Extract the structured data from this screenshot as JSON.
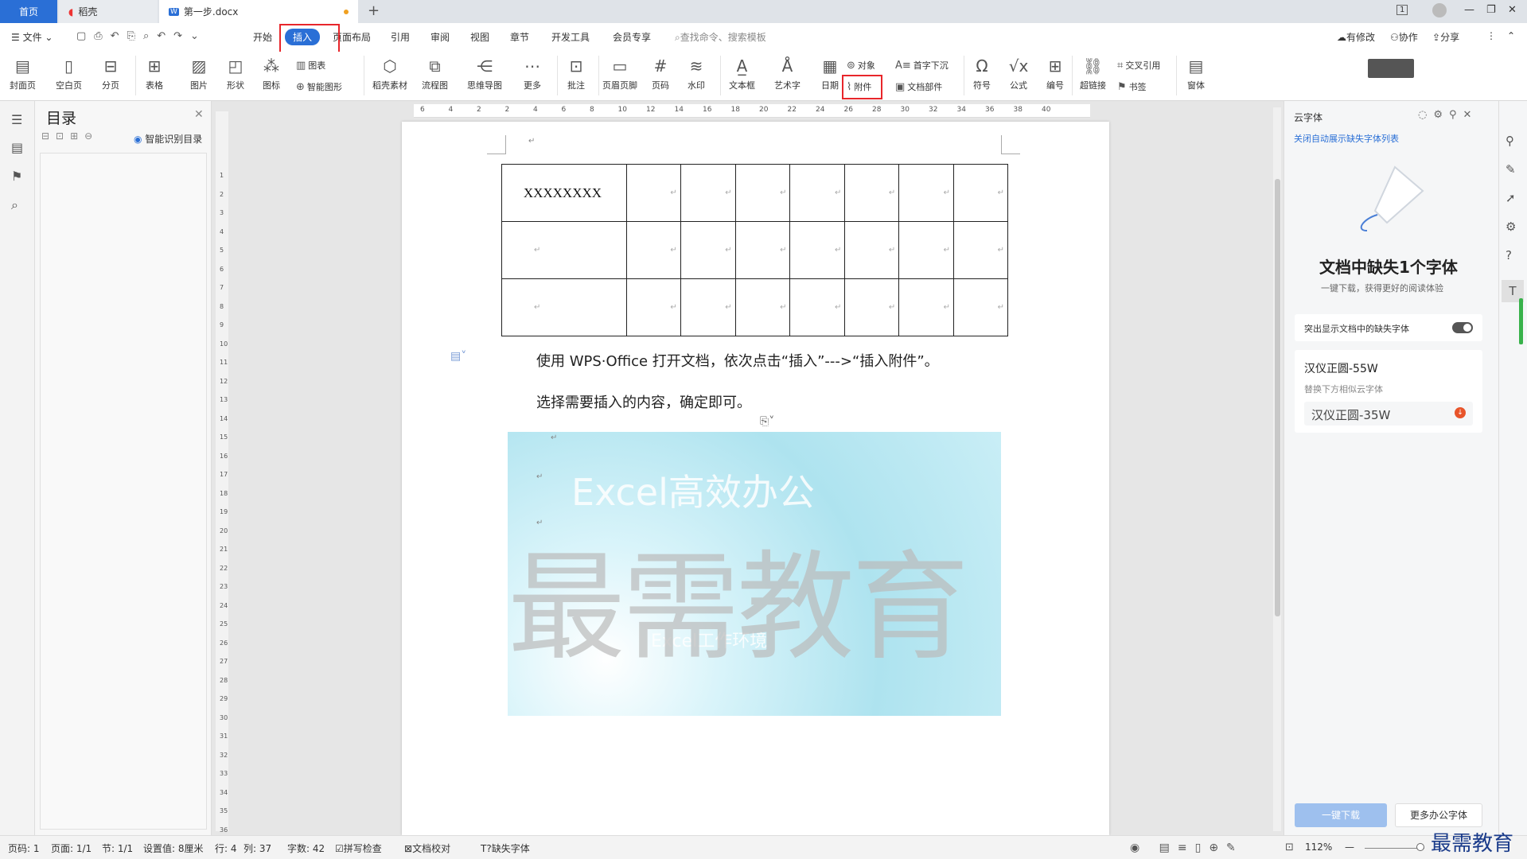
{
  "tabs": {
    "home": "首页",
    "docer": "稻壳",
    "doc": "第一步.docx",
    "add": "+"
  },
  "window": {
    "user_count": "1",
    "min": "—",
    "restore": "❐",
    "close": "✕"
  },
  "menu": {
    "file": "文件",
    "items": [
      "开始",
      "插入",
      "页面布局",
      "引用",
      "审阅",
      "视图",
      "章节",
      "开发工具",
      "会员专享"
    ],
    "search": "查找命令、搜索模板",
    "modified": "有修改",
    "collab": "协作",
    "share": "分享"
  },
  "ribbon": {
    "cover": "封面页",
    "blank": "空白页",
    "pagebreak": "分页",
    "table": "表格",
    "picture": "图片",
    "shape": "形状",
    "icon": "图标",
    "chart": "图表",
    "smartart": "智能图形",
    "docer_material": "稻壳素材",
    "flowchart": "流程图",
    "mindmap": "思维导图",
    "more": "更多",
    "comment": "批注",
    "header_footer": "页眉页脚",
    "page_num": "页码",
    "watermark": "水印",
    "textbox": "文本框",
    "wordart": "艺术字",
    "date": "日期",
    "object": "对象",
    "attachment": "附件",
    "dropcap": "首字下沉",
    "doc_parts": "文档部件",
    "symbol": "符号",
    "formula": "公式",
    "numbering": "编号",
    "hyperlink": "超链接",
    "crossref": "交叉引用",
    "bookmark": "书签",
    "window": "窗体"
  },
  "toc": {
    "title": "目录",
    "smart": "智能识别目录"
  },
  "document": {
    "cell_text": "XXXXXXXX",
    "para1": "使用 WPS·Office 打开文档，依次点击“插入”--->“插入附件”。",
    "para2": "选择需要插入的内容，确定即可。",
    "mark": "↵",
    "image_text1": "Excel高效办公",
    "image_text2": "Excel工作环境",
    "watermark": "最需教育"
  },
  "ruler": {
    "h": [
      "6",
      "4",
      "2",
      "2",
      "4",
      "6",
      "8",
      "10",
      "12",
      "14",
      "16",
      "18",
      "20",
      "22",
      "24",
      "26",
      "28",
      "30",
      "32",
      "34",
      "36",
      "38",
      "40"
    ],
    "v": [
      "1",
      "2",
      "3",
      "4",
      "5",
      "6",
      "7",
      "8",
      "9",
      "10",
      "11",
      "12",
      "13",
      "14",
      "15",
      "16",
      "17",
      "18",
      "19",
      "20",
      "21",
      "22",
      "23",
      "24",
      "25",
      "26",
      "27",
      "28",
      "29",
      "30",
      "31",
      "32",
      "33",
      "34",
      "35",
      "36"
    ]
  },
  "panel": {
    "title": "云字体",
    "link": "关闭自动展示缺失字体列表",
    "heading": "文档中缺失1个字体",
    "sub": "一键下载，获得更好的阅读体验",
    "toggle_label": "突出显示文档中的缺失字体",
    "font_name": "汉仪正圆-55W",
    "replace_hint": "替换下方相似云字体",
    "replace_font": "汉仪正圆-35W",
    "download": "一键下载",
    "more_fonts": "更多办公字体"
  },
  "status": {
    "page": "页码: 1",
    "pages": "页面: 1/1",
    "section": "节: 1/1",
    "setting": "设置值: 8厘米",
    "row": "行: 4",
    "col": "列: 37",
    "words": "字数: 42",
    "spell": "拼写检查",
    "proof": "文档校对",
    "missing_font": "缺失字体",
    "zoom": "112%"
  },
  "brand": "最需教育"
}
